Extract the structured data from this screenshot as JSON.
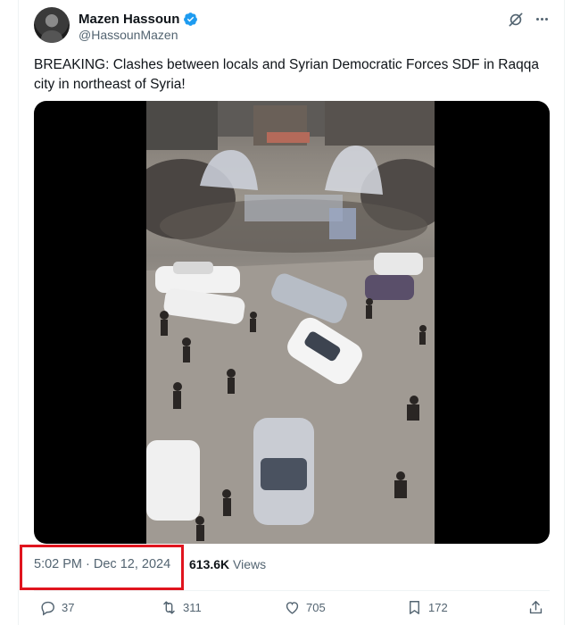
{
  "author": {
    "display_name": "Mazen Hassoun",
    "handle": "@HassounMazen",
    "verified_icon": "verified-badge-icon",
    "verified_color": "#1d9bf0"
  },
  "header_icons": [
    "grok-icon",
    "more-options-icon"
  ],
  "tweet": {
    "text": "BREAKING: Clashes between locals and Syrian Democratic Forces SDF in Raqqa city in northeast of Syria!"
  },
  "media": {
    "type": "video",
    "description_icon": "video-thumbnail"
  },
  "meta": {
    "timestamp": "5:02 PM · Dec 12, 2024",
    "views_count": "613.6K",
    "views_label": "Views",
    "highlight_color": "#e0141e"
  },
  "actions": {
    "reply": {
      "icon": "reply-icon",
      "count": "37"
    },
    "retweet": {
      "icon": "retweet-icon",
      "count": "311"
    },
    "like": {
      "icon": "heart-icon",
      "count": "705"
    },
    "bookmark": {
      "icon": "bookmark-icon",
      "count": "172"
    },
    "share": {
      "icon": "share-icon"
    }
  },
  "colors": {
    "text_primary": "#0f1419",
    "text_secondary": "#536471",
    "border": "#eff3f4"
  }
}
